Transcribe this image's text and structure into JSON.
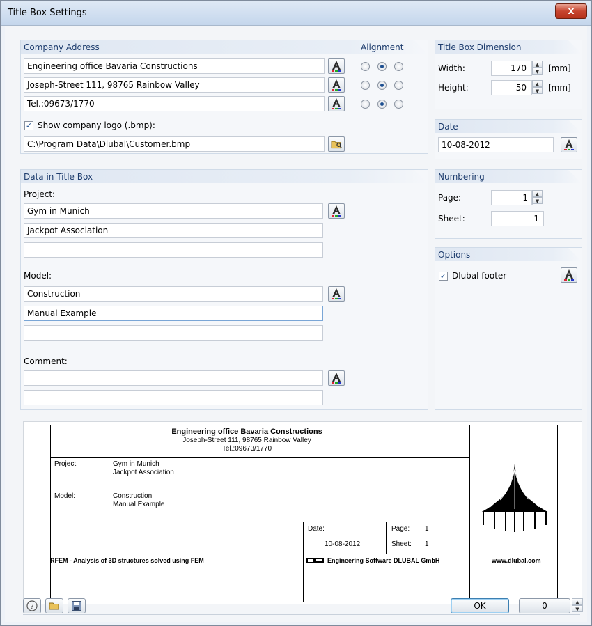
{
  "window": {
    "title": "Title Box Settings",
    "close": "x"
  },
  "company": {
    "group_title": "Company Address",
    "alignment_title": "Alignment",
    "lines": [
      {
        "value": "Engineering office Bavaria Constructions",
        "align": 1
      },
      {
        "value": "Joseph-Street 111, 98765 Rainbow Valley",
        "align": 1
      },
      {
        "value": "Tel.:09673/1770",
        "align": 1
      }
    ],
    "show_logo_label": "Show company logo (.bmp):",
    "show_logo_checked": true,
    "logo_path": "C:\\Program Data\\Dlubal\\Customer.bmp"
  },
  "dimension": {
    "group_title": "Title Box Dimension",
    "width_label": "Width:",
    "width_value": "170",
    "width_unit": "[mm]",
    "height_label": "Height:",
    "height_value": "50",
    "height_unit": "[mm]"
  },
  "date": {
    "group_title": "Date",
    "value": "10-08-2012"
  },
  "data": {
    "group_title": "Data in Title Box",
    "project_label": "Project:",
    "project_lines": [
      "Gym in Munich",
      "Jackpot Association",
      ""
    ],
    "model_label": "Model:",
    "model_lines": [
      "Construction",
      "Manual Example",
      ""
    ],
    "comment_label": "Comment:",
    "comment_lines": [
      "",
      ""
    ]
  },
  "numbering": {
    "group_title": "Numbering",
    "page_label": "Page:",
    "page_value": "1",
    "sheet_label": "Sheet:",
    "sheet_value": "1"
  },
  "options": {
    "group_title": "Options",
    "footer_label": "Dlubal footer",
    "footer_checked": true
  },
  "preview": {
    "company_line1": "Engineering office Bavaria Constructions",
    "company_line2": "Joseph-Street 111, 98765 Rainbow Valley",
    "company_line3": "Tel.:09673/1770",
    "project_label": "Project:",
    "project_line1": "Gym in Munich",
    "project_line2": "Jackpot Association",
    "model_label": "Model:",
    "model_line1": "Construction",
    "model_line2": "Manual Example",
    "date_label": "Date:",
    "date_value": "10-08-2012",
    "page_label": "Page:",
    "page_value": "1",
    "sheet_label": "Sheet:",
    "sheet_value": "1",
    "footer_left": "RFEM - Analysis of 3D structures solved using FEM",
    "footer_mid": "Engineering Software DLUBAL GmbH",
    "footer_right": "www.dlubal.com"
  },
  "buttons": {
    "ok": "OK",
    "counter": "0"
  }
}
